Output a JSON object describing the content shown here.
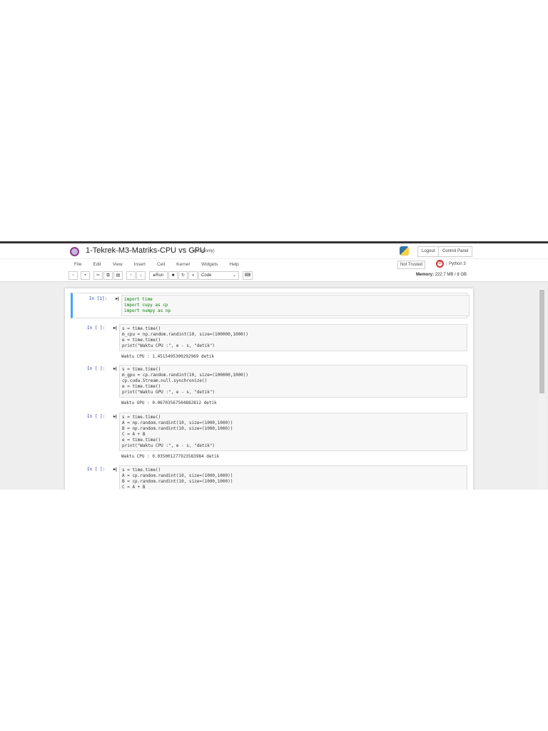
{
  "header": {
    "title": "1-Tekrek-M3-Matriks-CPU vs GPU",
    "readonly": "(read only)",
    "logout": "Logout",
    "control_panel": "Control Panel"
  },
  "menu": [
    "File",
    "Edit",
    "View",
    "Insert",
    "Cell",
    "Kernel",
    "Widgets",
    "Help"
  ],
  "status": {
    "trusted": "Not Trusted",
    "kernel": "Python 3",
    "memory_label": "Memory:",
    "memory_value": "222.7 MB / 8 GB"
  },
  "toolbar": {
    "run": "Run",
    "cell_type": "Code"
  },
  "cells": [
    {
      "prompt": "In [1]:",
      "lines": [
        "import time",
        "import cupy as cp",
        "import numpy as np"
      ],
      "output": ""
    },
    {
      "prompt": "In [ ]:",
      "lines": [
        "s = time.time()",
        "m_cpu = np.random.randint(10, size=(100000,1000))",
        "e = time.time()",
        "print(\"Waktu CPU :\", e - s, \"detik\")"
      ],
      "output": "Waktu CPU : 1.4515495300292969 detik"
    },
    {
      "prompt": "In [ ]:",
      "lines": [
        "s = time.time()",
        "m_gpu = cp.random.randint(10, size=(100000,1000))",
        "cp.cuda.Stream.null.synchronize()",
        "e = time.time()",
        "print(\"Waktu GPU :\", e - s, \"detik\")"
      ],
      "output": "Waktu GPU : 0.06703567504882812 detik"
    },
    {
      "prompt": "In [ ]:",
      "lines": [
        "s = time.time()",
        "A = np.random.randint(10, size=(1000,1000))",
        "B = np.random.randint(10, size=(1000,1000))",
        "C = A + B",
        "e = time.time()",
        "print(\"Waktu CPU :\", e - s, \"detik\")"
      ],
      "output": "Waktu CPU : 0.035001277923583984 detik"
    },
    {
      "prompt": "In [ ]:",
      "lines": [
        "s = time.time()",
        "A = cp.random.randint(10, size=(1000,1000))",
        "B = cp.random.randint(10, size=(1000,1000))",
        "C = A + B"
      ],
      "output": ""
    }
  ]
}
